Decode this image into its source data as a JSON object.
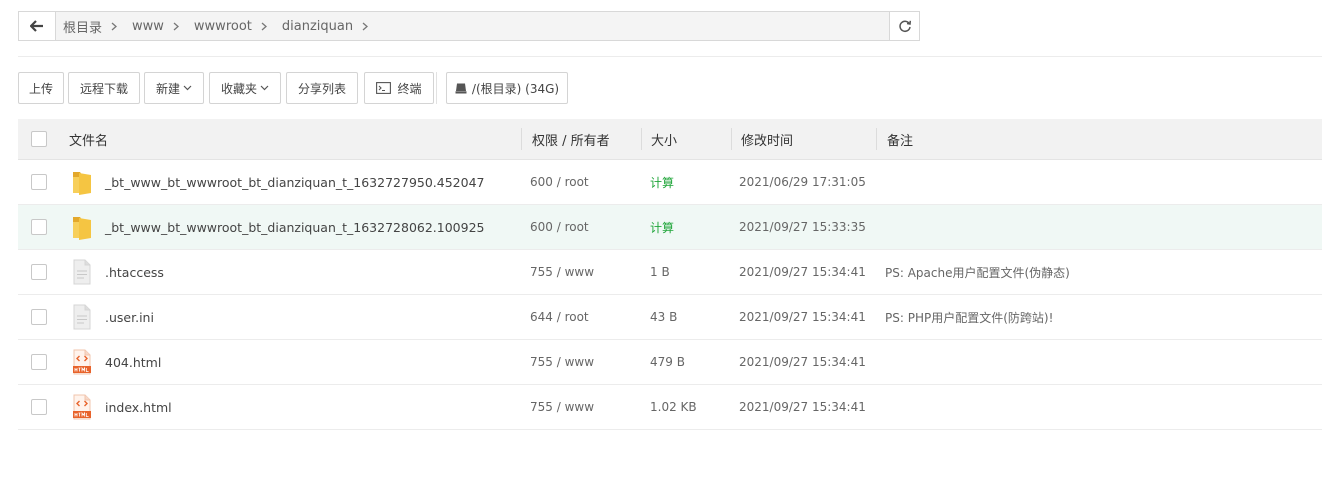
{
  "pathbar": {
    "crumbs": [
      {
        "label": "根目录"
      },
      {
        "label": "www"
      },
      {
        "label": "wwwroot"
      },
      {
        "label": "dianziquan"
      }
    ]
  },
  "toolbar": {
    "upload": "上传",
    "remote_download": "远程下载",
    "new": "新建",
    "favorites": "收藏夹",
    "share_list": "分享列表",
    "terminal": "终端",
    "disk": "/(根目录) (34G)"
  },
  "table": {
    "headers": {
      "name": "文件名",
      "perm_owner": "权限 / 所有者",
      "size": "大小",
      "mtime": "修改时间",
      "note": "备注"
    },
    "rows": [
      {
        "icon": "folder-icon",
        "name": "_bt_www_bt_wwwroot_bt_dianziquan_t_1632727950.452047",
        "perm": "600 / root",
        "size": "计算",
        "mtime": "2021/06/29 17:31:05",
        "note": ""
      },
      {
        "icon": "folder-icon",
        "name": "_bt_www_bt_wwwroot_bt_dianziquan_t_1632728062.100925",
        "perm": "600 / root",
        "size": "计算",
        "mtime": "2021/09/27 15:33:35",
        "note": ""
      },
      {
        "icon": "text-file-icon",
        "name": ".htaccess",
        "perm": "755 / www",
        "size": "1 B",
        "mtime": "2021/09/27 15:34:41",
        "note": "PS: Apache用户配置文件(伪静态)"
      },
      {
        "icon": "text-file-icon",
        "name": ".user.ini",
        "perm": "644 / root",
        "size": "43 B",
        "mtime": "2021/09/27 15:34:41",
        "note": "PS: PHP用户配置文件(防跨站)!"
      },
      {
        "icon": "html-file-icon",
        "name": "404.html",
        "perm": "755 / www",
        "size": "479 B",
        "mtime": "2021/09/27 15:34:41",
        "note": ""
      },
      {
        "icon": "html-file-icon",
        "name": "index.html",
        "perm": "755 / www",
        "size": "1.02 KB",
        "mtime": "2021/09/27 15:34:41",
        "note": ""
      }
    ]
  },
  "colors": {
    "accent_green": "#20a53a",
    "folder_yellow": "#f5c542",
    "html_orange": "#e8632b",
    "row_highlight": "#f0f8f5"
  }
}
